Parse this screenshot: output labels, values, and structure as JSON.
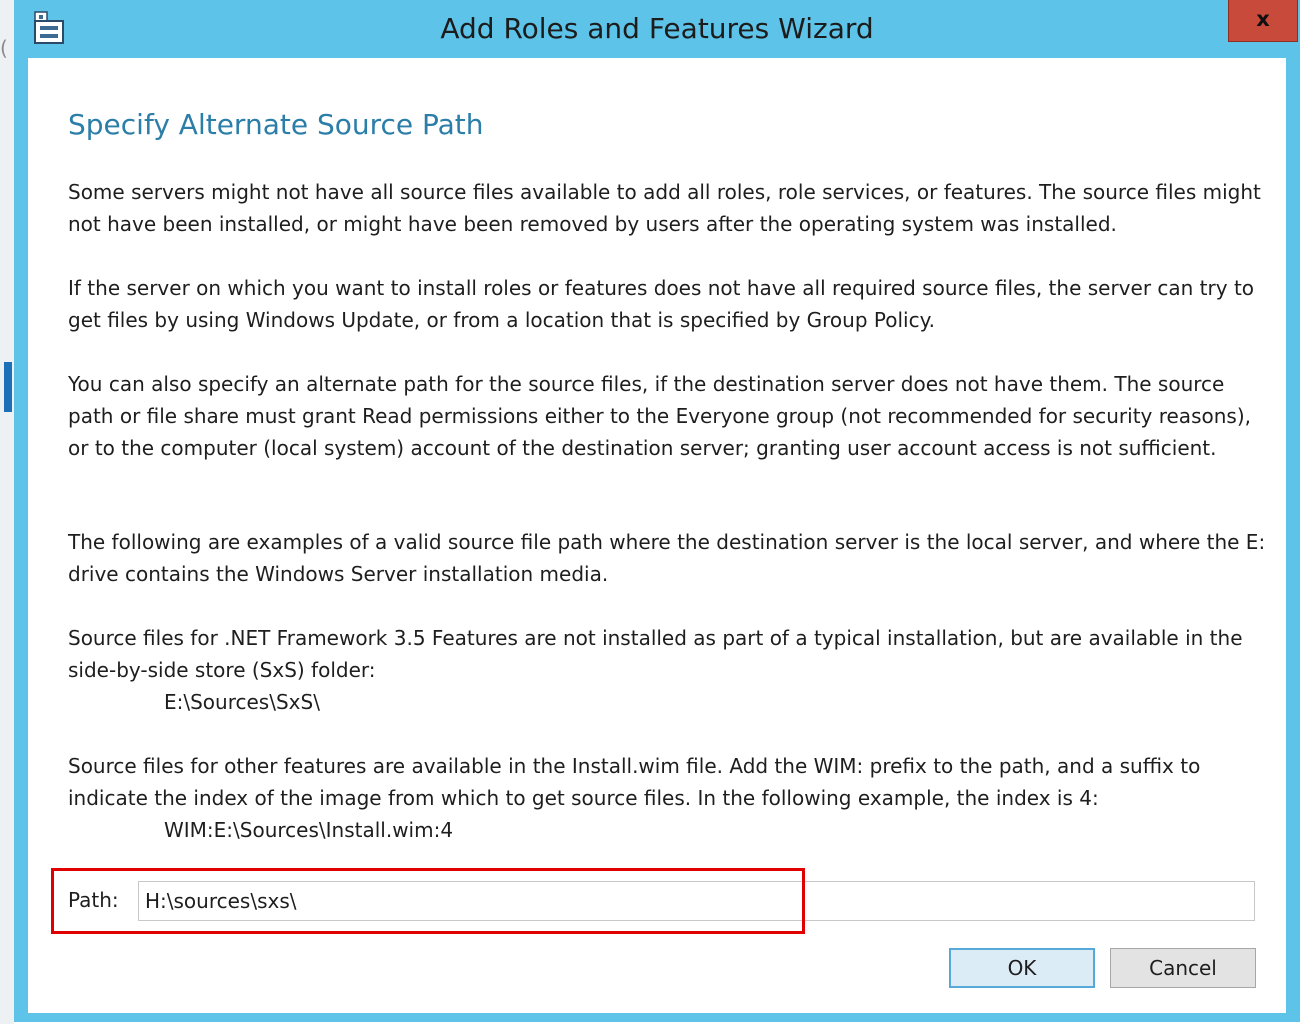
{
  "window": {
    "title": "Add Roles and Features Wizard",
    "close_label": "x",
    "accent_color": "#5ec3e8"
  },
  "dialog": {
    "heading": "Specify Alternate Source Path",
    "paragraphs": [
      "Some servers might not have all source files available to add all roles, role services, or features. The source files might not have been installed, or might have been removed by users after the operating system was installed.",
      "If the server on which you want to install roles or features does not have all required source files, the server can try to get files by using Windows Update, or from a location that is specified by Group Policy.",
      "You can also specify an alternate path for the source files, if the destination server does not have them. The source path or file share must grant Read permissions either to the Everyone group (not recommended for security reasons), or to the computer (local system) account of the destination server; granting user account access is not sufficient.",
      "The following are examples of a valid source file path where the destination server is the local server, and where the E: drive contains the Windows Server installation media.",
      "Source files for .NET Framework 3.5 Features are not installed as part of a typical installation, but are available in the side-by-side store (SxS) folder:",
      "Source files for other features are available in the Install.wim file. Add the WIM: prefix to the path, and a suffix to indicate the index of the image from which to get source files. In the following example, the index is 4:"
    ],
    "examples": {
      "sxs": "E:\\Sources\\SxS\\",
      "wim": "WIM:E:\\Sources\\Install.wim:4"
    },
    "path_label": "Path:",
    "path_value": "H:\\sources\\sxs\\",
    "ok_label": "OK",
    "cancel_label": "Cancel"
  },
  "annotation": {
    "highlight_color": "#e00000"
  }
}
